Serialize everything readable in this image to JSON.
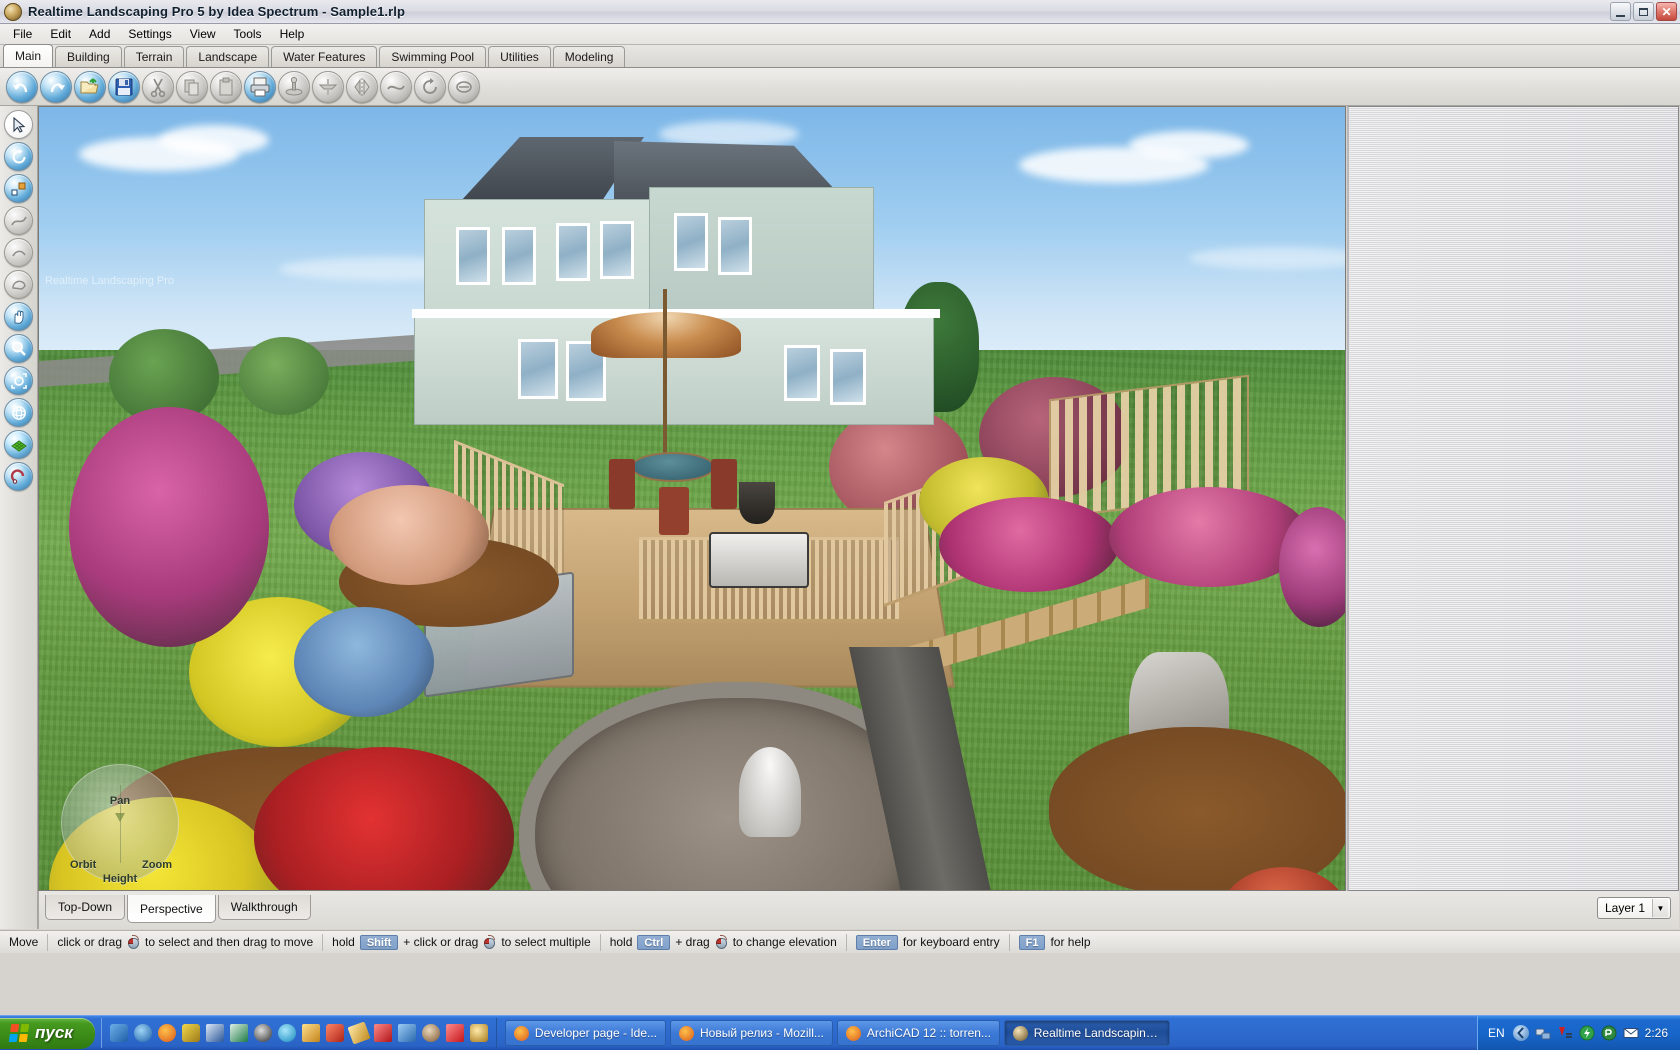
{
  "window": {
    "title": "Realtime Landscaping Pro 5 by Idea Spectrum - Sample1.rlp",
    "app_icon": "app-globe-icon",
    "controls": {
      "minimize": "minimize-icon",
      "restore": "restore-icon",
      "close": "close-icon"
    }
  },
  "menu": {
    "items": [
      {
        "label": "File"
      },
      {
        "label": "Edit"
      },
      {
        "label": "Add"
      },
      {
        "label": "Settings"
      },
      {
        "label": "View"
      },
      {
        "label": "Tools"
      },
      {
        "label": "Help"
      }
    ]
  },
  "ribbon_tabs": {
    "active": "Main",
    "items": [
      {
        "label": "Main",
        "active": true
      },
      {
        "label": "Building",
        "active": false
      },
      {
        "label": "Terrain",
        "active": false
      },
      {
        "label": "Landscape",
        "active": false
      },
      {
        "label": "Water Features",
        "active": false
      },
      {
        "label": "Swimming Pool",
        "active": false
      },
      {
        "label": "Utilities",
        "active": false
      },
      {
        "label": "Modeling",
        "active": false
      }
    ]
  },
  "toolbar": {
    "buttons": [
      {
        "name": "undo-icon",
        "enabled": true
      },
      {
        "name": "redo-icon",
        "enabled": true
      },
      {
        "name": "open-folder-icon",
        "enabled": true
      },
      {
        "name": "save-icon",
        "enabled": true
      },
      {
        "name": "cut-icon",
        "enabled": false
      },
      {
        "name": "copy-icon",
        "enabled": false
      },
      {
        "name": "paste-icon",
        "enabled": false
      },
      {
        "name": "print-icon",
        "enabled": true
      },
      {
        "name": "group-icon",
        "enabled": false
      },
      {
        "name": "ungroup-icon",
        "enabled": false
      },
      {
        "name": "mirror-icon",
        "enabled": false
      },
      {
        "name": "smooth-icon",
        "enabled": false
      },
      {
        "name": "rotate-icon",
        "enabled": false
      },
      {
        "name": "align-icon",
        "enabled": false
      }
    ]
  },
  "left_toolbar": {
    "buttons": [
      {
        "name": "select-arrow-icon",
        "style": "white",
        "enabled": true
      },
      {
        "name": "rotate-object-icon",
        "style": "blue",
        "enabled": true
      },
      {
        "name": "scale-object-icon",
        "style": "blue",
        "enabled": true
      },
      {
        "name": "draw-polyline-icon",
        "style": "dim",
        "enabled": false
      },
      {
        "name": "draw-arc-icon",
        "style": "dim",
        "enabled": false
      },
      {
        "name": "draw-shape-icon",
        "style": "dim",
        "enabled": false
      },
      {
        "name": "pan-hand-icon",
        "style": "blue",
        "enabled": true
      },
      {
        "name": "zoom-magnifier-icon",
        "style": "blue",
        "enabled": true
      },
      {
        "name": "zoom-extents-icon",
        "style": "blue",
        "enabled": true
      },
      {
        "name": "orbit-camera-icon",
        "style": "blue",
        "enabled": true
      },
      {
        "name": "terrain-grid-icon",
        "style": "blue",
        "enabled": true
      },
      {
        "name": "measure-tool-icon",
        "style": "blue",
        "enabled": true
      }
    ]
  },
  "viewport": {
    "overlay_label": "Realtime Landscaping Pro",
    "nav_widget": {
      "orbit": "Orbit",
      "zoom": "Zoom",
      "pan": "Pan",
      "height": "Height"
    }
  },
  "view_tabs": {
    "active": "Perspective",
    "items": [
      {
        "label": "Top-Down",
        "active": false
      },
      {
        "label": "Perspective",
        "active": true
      },
      {
        "label": "Walkthrough",
        "active": false
      }
    ]
  },
  "layer_selector": {
    "value": "Layer 1",
    "dropdown_icon": "chevron-down-icon"
  },
  "status_bar": {
    "mode": "Move",
    "hints": [
      {
        "pre": "click or drag",
        "mouse": true,
        "post": "to select and then drag to move"
      },
      {
        "pre": "hold",
        "key": "Shift",
        "mid": "+ click or drag",
        "mouse": true,
        "post": "to select multiple"
      },
      {
        "pre": "hold",
        "key": "Ctrl",
        "mid": "+ drag",
        "mouse": true,
        "post": "to change elevation"
      },
      {
        "key": "Enter",
        "post": "for keyboard entry"
      },
      {
        "key": "F1",
        "post": "for help"
      }
    ]
  },
  "taskbar": {
    "start_label": "пуск",
    "quick_launch": [
      {
        "name": "show-desktop-icon",
        "color": "#2f7fc4"
      },
      {
        "name": "internet-explorer-icon",
        "color": "#2c7fd6"
      },
      {
        "name": "firefox-icon",
        "color": "#e8802a"
      },
      {
        "name": "paint-icon",
        "color": "#d6c23a"
      },
      {
        "name": "word-icon",
        "color": "#2b5797"
      },
      {
        "name": "excel-icon",
        "color": "#217346"
      },
      {
        "name": "media-player-icon",
        "color": "#3a3a3a"
      },
      {
        "name": "messenger-icon",
        "color": "#3fb3e3"
      },
      {
        "name": "total-commander-icon",
        "color": "#d99b2b"
      },
      {
        "name": "utility-red-icon",
        "color": "#cc3322"
      },
      {
        "name": "notes-icon",
        "color": "#d9a73a"
      },
      {
        "name": "acrobat-icon",
        "color": "#cc2229"
      },
      {
        "name": "usb-icon",
        "color": "#3a7fd6"
      },
      {
        "name": "picture-viewer-icon",
        "color": "#9a6b3a"
      },
      {
        "name": "ebay-icon",
        "color": "#d32f2f"
      },
      {
        "name": "clock-utility-icon",
        "color": "#c49a2c"
      }
    ],
    "tasks": [
      {
        "label": "Developer page - Ide...",
        "icon": "firefox-icon",
        "active": false
      },
      {
        "label": "Новый релиз - Mozill...",
        "icon": "firefox-icon",
        "active": false
      },
      {
        "label": "ArchiCAD 12 :: torren...",
        "icon": "firefox-icon",
        "active": false
      },
      {
        "label": "Realtime Landscaping...",
        "icon": "app-globe-icon",
        "active": true
      }
    ],
    "tray": {
      "language": "EN",
      "icons": [
        {
          "name": "show-hidden-icons-icon"
        },
        {
          "name": "network-icon"
        },
        {
          "name": "volume-red-icon"
        },
        {
          "name": "update-icon"
        },
        {
          "name": "antivirus-icon"
        },
        {
          "name": "mail-icon"
        }
      ],
      "clock": "2:26"
    }
  },
  "colors": {
    "titlebar_text": "#11202f",
    "taskbar_blue": "#2f6cd0",
    "start_green": "#3c8c18",
    "accent_key_blue": "#7fa0c9",
    "sky": "#9fcdf0",
    "grass": "#74ab4e"
  }
}
